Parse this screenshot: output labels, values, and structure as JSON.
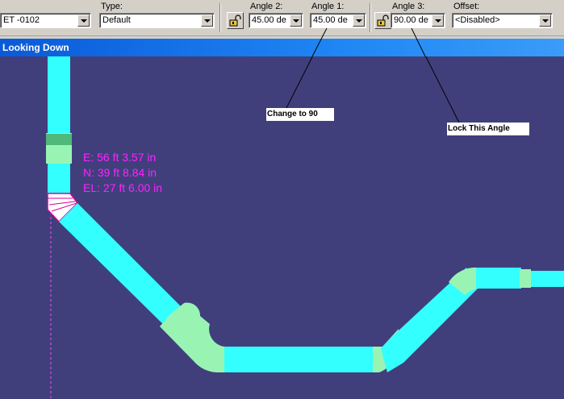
{
  "toolbar": {
    "item_value": "ET -0102",
    "type_label": "Type:",
    "type_value": "Default",
    "angle2_label": "Angle 2:",
    "angle2_value": "45.00 de",
    "angle1_label": "Angle 1:",
    "angle1_value": "45.00 de",
    "angle3_label": "Angle 3:",
    "angle3_value": "90.00 de",
    "offset_label": "Offset:",
    "offset_value": "<Disabled>"
  },
  "view": {
    "title": "Looking Down"
  },
  "annotations": {
    "change_note": "Change to 90",
    "lock_note": "Lock This Angle"
  },
  "coordinates": {
    "east": "E: 56 ft  3.57 in",
    "north": "N: 39 ft  8.84 in",
    "elevation": "EL: 27 ft  6.00 in"
  },
  "colors": {
    "pipe": "#33ffff",
    "fitting": "#99f4b4",
    "background": "#403f7c",
    "coordinate_text": "#ff22ff"
  }
}
